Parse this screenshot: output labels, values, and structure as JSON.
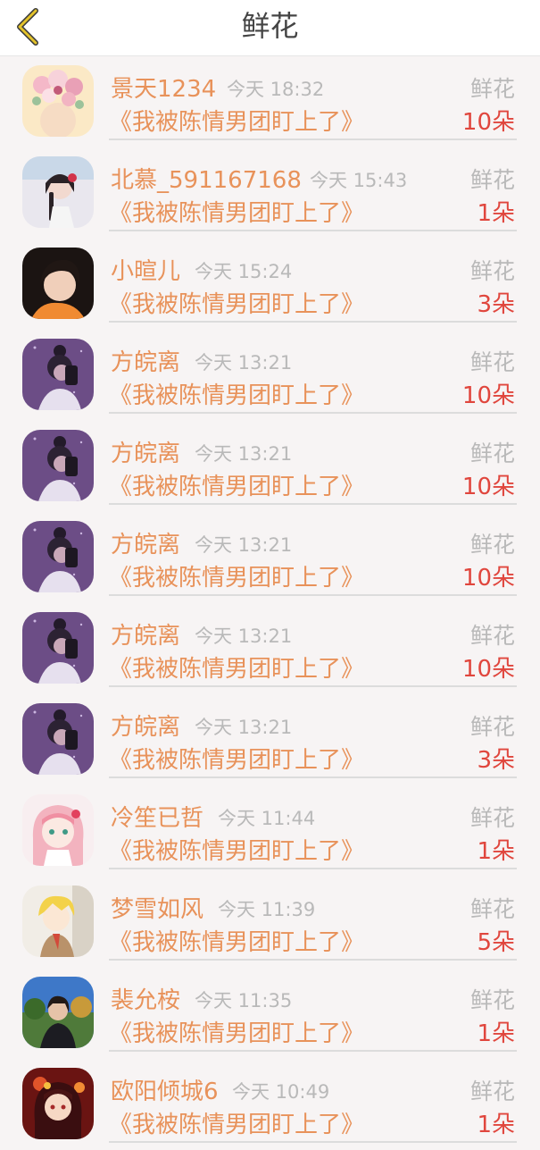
{
  "header": {
    "title": "鲜花",
    "back_icon": "chevron-left-icon"
  },
  "colors": {
    "accent": "#e8925a",
    "count": "#e0463d",
    "muted": "#b9b9b9"
  },
  "entries": [
    {
      "name": "景天1234",
      "time": "今天 18:32",
      "type": "鲜花",
      "book": "《我被陈情男团盯上了》",
      "count": "10朵",
      "avatar": "flowers"
    },
    {
      "name": "北慕_591167168",
      "time": "今天 15:43",
      "type": "鲜花",
      "book": "《我被陈情男团盯上了》",
      "count": "1朵",
      "avatar": "braid-girl"
    },
    {
      "name": "小暄儿",
      "time": "今天 15:24",
      "type": "鲜花",
      "book": "《我被陈情男团盯上了》",
      "count": "3朵",
      "avatar": "dark-hair"
    },
    {
      "name": "方皖离",
      "time": "今天 13:21",
      "type": "鲜花",
      "book": "《我被陈情男团盯上了》",
      "count": "10朵",
      "avatar": "purple-selfie"
    },
    {
      "name": "方皖离",
      "time": "今天 13:21",
      "type": "鲜花",
      "book": "《我被陈情男团盯上了》",
      "count": "10朵",
      "avatar": "purple-selfie"
    },
    {
      "name": "方皖离",
      "time": "今天 13:21",
      "type": "鲜花",
      "book": "《我被陈情男团盯上了》",
      "count": "10朵",
      "avatar": "purple-selfie"
    },
    {
      "name": "方皖离",
      "time": "今天 13:21",
      "type": "鲜花",
      "book": "《我被陈情男团盯上了》",
      "count": "10朵",
      "avatar": "purple-selfie"
    },
    {
      "name": "方皖离",
      "time": "今天 13:21",
      "type": "鲜花",
      "book": "《我被陈情男团盯上了》",
      "count": "3朵",
      "avatar": "purple-selfie"
    },
    {
      "name": "冷笙已哲",
      "time": "今天 11:44",
      "type": "鲜花",
      "book": "《我被陈情男团盯上了》",
      "count": "1朵",
      "avatar": "pink-anime"
    },
    {
      "name": "梦雪如风",
      "time": "今天 11:39",
      "type": "鲜花",
      "book": "《我被陈情男团盯上了》",
      "count": "5朵",
      "avatar": "blond-anime"
    },
    {
      "name": "裴允桉",
      "time": "今天 11:35",
      "type": "鲜花",
      "book": "《我被陈情男团盯上了》",
      "count": "1朵",
      "avatar": "outdoor-photo"
    },
    {
      "name": "欧阳倾城6",
      "time": "今天 10:49",
      "type": "鲜花",
      "book": "《我被陈情男团盯上了》",
      "count": "1朵",
      "avatar": "red-anime"
    }
  ]
}
